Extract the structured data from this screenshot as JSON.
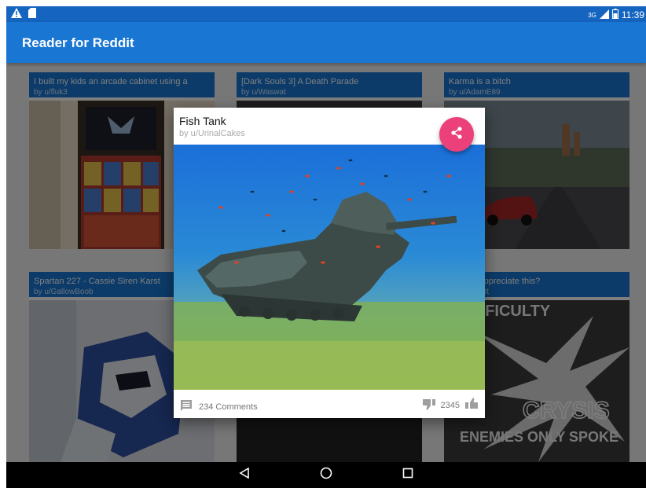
{
  "status_bar": {
    "network": "3G",
    "time": "11:39"
  },
  "app": {
    "title": "Reader for Reddit",
    "accent": "#1976d2",
    "fab_color": "#ec407a"
  },
  "posts": [
    {
      "title": "I built my kids an arcade cabinet using a",
      "author": "by u/fluk3"
    },
    {
      "title": "[Dark Souls 3] A Death Parade",
      "author": "by u/Waswat"
    },
    {
      "title": "Karma is a bitch",
      "author": "by u/AdamE89"
    },
    {
      "title": "Spartan 227 - Cassie Siren Karst",
      "author": "by u/GallowBoob"
    },
    {
      "title": "he else appreciate this?",
      "author": "ertACorbett"
    }
  ],
  "dialog": {
    "title": "Fish Tank",
    "author": "by u/UrinalCakes",
    "comments": "234 Comments",
    "score": "2345"
  },
  "background_text": {
    "crysis_top": "DIFFICULTY",
    "crysis_brand": "CRYSIS",
    "crysis_tag": "ENEMIES ONLY SPOKE"
  },
  "icons": {
    "warning": "warning-icon",
    "sd": "sd-card-icon",
    "battery": "battery-icon",
    "share": "share-icon",
    "comment": "comment-icon",
    "downvote": "thumb-down-icon",
    "upvote": "thumb-up-icon",
    "back": "back-icon",
    "home": "home-icon",
    "recents": "recents-icon"
  }
}
